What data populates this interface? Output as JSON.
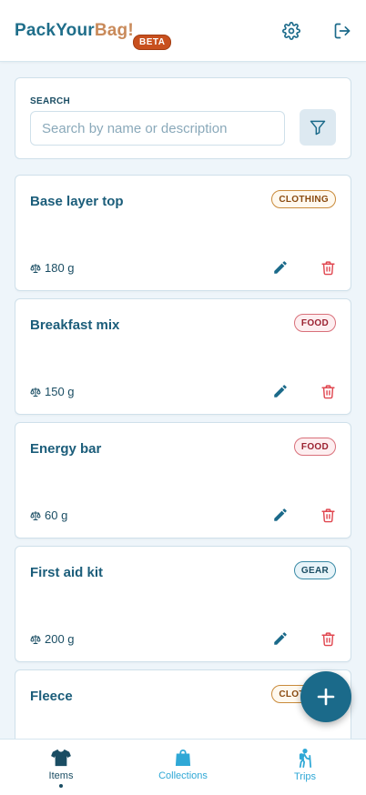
{
  "app": {
    "logo_part1": "Pack",
    "logo_part2": "Your",
    "logo_part3": "Bag!",
    "beta_label": "BETA"
  },
  "header": {
    "settings_icon": "gear-icon",
    "logout_icon": "logout-icon"
  },
  "search": {
    "label": "SEARCH",
    "placeholder": "Search by name or description",
    "value": ""
  },
  "items": [
    {
      "name": "Base layer top",
      "category": "CLOTHING",
      "weight": "180 g"
    },
    {
      "name": "Breakfast mix",
      "category": "FOOD",
      "weight": "150 g"
    },
    {
      "name": "Energy bar",
      "category": "FOOD",
      "weight": "60 g"
    },
    {
      "name": "First aid kit",
      "category": "GEAR",
      "weight": "200 g"
    },
    {
      "name": "Fleece",
      "category": "CLOTHING",
      "weight": ""
    }
  ],
  "nav": {
    "items": [
      {
        "label": "Items",
        "icon": "shirt-icon",
        "active": true
      },
      {
        "label": "Collections",
        "icon": "bag-icon",
        "active": false
      },
      {
        "label": "Trips",
        "icon": "hiker-icon",
        "active": false
      }
    ]
  },
  "colors": {
    "primary": "#1b6a8a",
    "accent": "#c98a5a",
    "beta": "#c8501e",
    "delete": "#e0464f",
    "nav_inactive": "#2fa8d6"
  }
}
